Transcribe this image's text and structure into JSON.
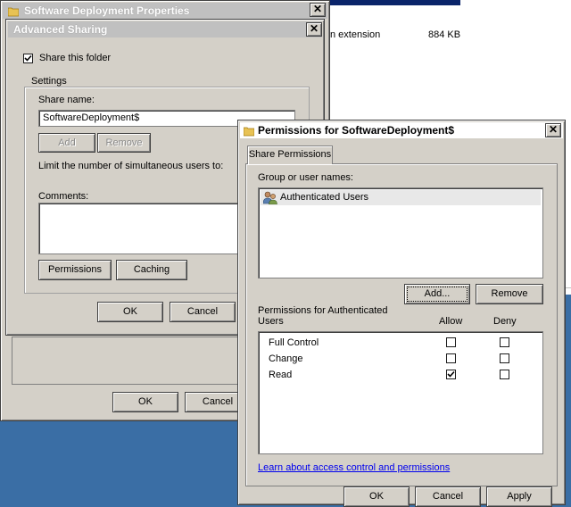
{
  "background_window": {
    "file_row": {
      "type_text": "n extension",
      "size_text": "884 KB"
    }
  },
  "properties_dialog": {
    "title": "Software Deployment Properties",
    "ok_label": "OK",
    "cancel_label": "Cancel"
  },
  "advanced_sharing": {
    "title": "Advanced Sharing",
    "share_checkbox_label": "Share this folder",
    "share_checked": true,
    "settings_group_label": "Settings",
    "share_name_label": "Share name:",
    "share_name_value": "SoftwareDeployment$",
    "add_label": "Add",
    "remove_label": "Remove",
    "limit_label": "Limit the number of simultaneous users to:",
    "comments_label": "Comments:",
    "comments_value": "",
    "permissions_label": "Permissions",
    "caching_label": "Caching",
    "ok_label": "OK",
    "cancel_label": "Cancel"
  },
  "permissions_dialog": {
    "title": "Permissions for SoftwareDeployment$",
    "tab_label": "Share Permissions",
    "group_list_label": "Group or user names:",
    "users": [
      {
        "name": "Authenticated Users",
        "icon": "users-icon"
      }
    ],
    "add_label": "Add...",
    "remove_label": "Remove",
    "perm_header_line1": "Permissions for Authenticated",
    "perm_header_line2": "Users",
    "allow_label": "Allow",
    "deny_label": "Deny",
    "permissions": [
      {
        "name": "Full Control",
        "allow": false,
        "deny": false
      },
      {
        "name": "Change",
        "allow": false,
        "deny": false
      },
      {
        "name": "Read",
        "allow": true,
        "deny": false
      }
    ],
    "learn_link": "Learn about access control and permissions",
    "ok_label": "OK",
    "cancel_label": "Cancel",
    "apply_label": "Apply"
  }
}
